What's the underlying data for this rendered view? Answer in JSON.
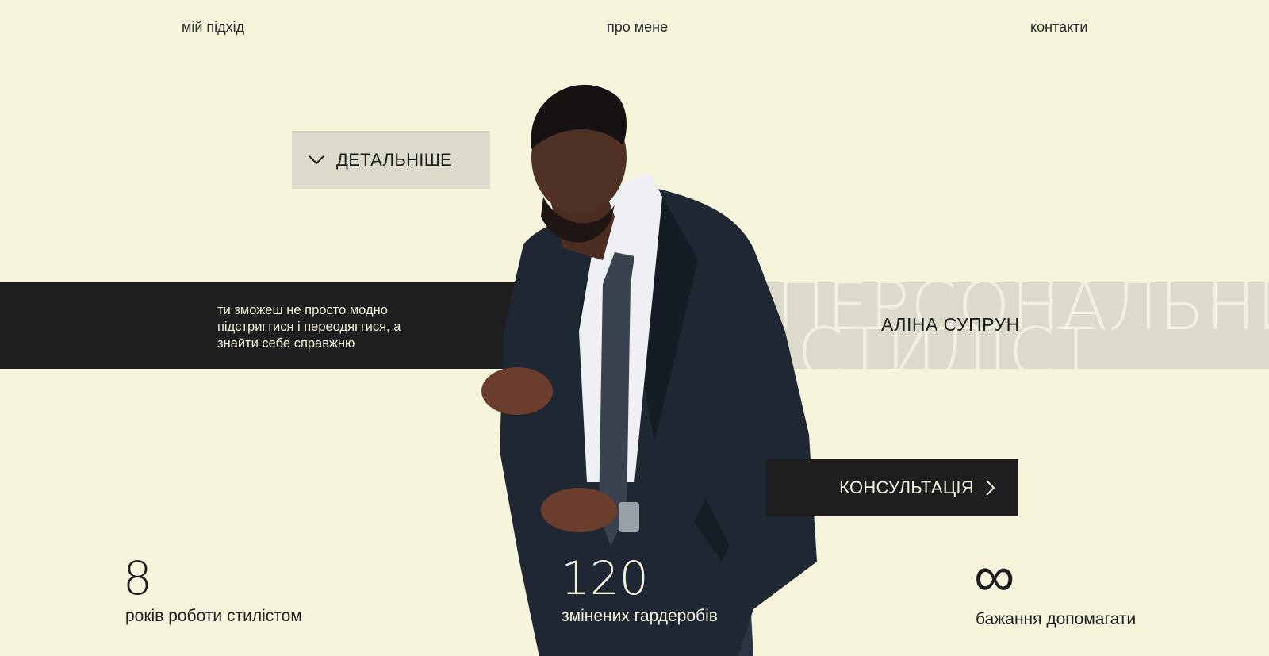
{
  "nav": {
    "approach": "мій підхід",
    "about": "про мене",
    "contacts": "контакти"
  },
  "hero": {
    "details_label": "ДЕТАЛЬНІШЕ",
    "tagline": "ти зможеш не просто модно підстригтися і переодягтися, а знайти себе справжню",
    "name": "АЛІНА СУПРУН",
    "bg_line1": "ПЕРСОНАЛЬНИЙ",
    "bg_line2": "СТИЛІСТ",
    "consult_label": "КОНСУЛЬТАЦІЯ"
  },
  "stats": [
    {
      "value": "8",
      "label": "років роботи стилістом"
    },
    {
      "value": "120",
      "label": "змінених гардеробів"
    },
    {
      "value": "∞",
      "label": "бажання допомагати"
    }
  ],
  "colors": {
    "background": "#f6f5dc",
    "dark": "#1e1e1e",
    "light_band": "#dcdacb",
    "text_light": "#f3f1dc"
  }
}
